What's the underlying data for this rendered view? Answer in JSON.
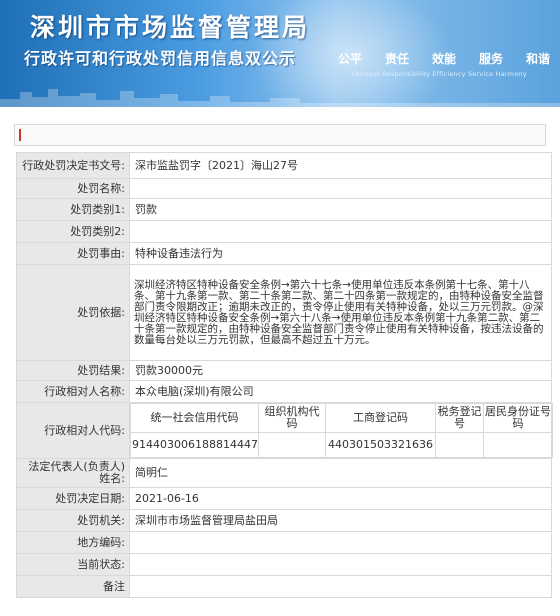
{
  "header": {
    "title": "深圳市市场监督管理局",
    "subtitle": "行政许可和行政处罚信用信息双公示",
    "slogans": [
      "公平",
      "责任",
      "效能",
      "服务",
      "和谐"
    ],
    "motto": "Fairness  Responsibility  Efficiency  Service  Harmony"
  },
  "record": {
    "decision_no_label": "行政处罚决定书文号:",
    "decision_no": "深市监盐罚字〔2021〕海山27号",
    "penalty_name_label": "处罚名称:",
    "penalty_name": "",
    "category1_label": "处罚类别1:",
    "category1": "罚款",
    "category2_label": "处罚类别2:",
    "category2": "",
    "cause_label": "处罚事由:",
    "cause": "特种设备违法行为",
    "basis_label": "处罚依据:",
    "basis": "深圳经济特区特种设备安全条例→第六十七条→使用单位违反本条例第十七条、第十八条、第十九条第一款、第二十条第二款、第二十四条第一款规定的，由特种设备安全监督部门责令限期改正；逾期未改正的，责令停止使用有关特种设备，处以三万元罚款。@深圳经济特区特种设备安全条例→第六十八条→使用单位违反本条例第十九条第二款、第二十条第一款规定的，由特种设备安全监督部门责令停止使用有关特种设备，按违法设备的数量每台处以三万元罚款，但最高不超过五十万元。",
    "result_label": "处罚结果:",
    "result": "罚款30000元",
    "party_name_label": "行政相对人名称:",
    "party_name": "本众电脑(深圳)有限公司",
    "party_code_label": "行政相对人代码:",
    "code_headers": [
      "统一社会信用代码",
      "组织机构代码",
      "工商登记码",
      "税务登记号",
      "居民身份证号码"
    ],
    "code_values": [
      "914403006188814447",
      "",
      "440301503321636",
      "",
      ""
    ],
    "legal_rep_label": "法定代表人(负责人)姓名:",
    "legal_rep": "简明仁",
    "decision_date_label": "处罚决定日期:",
    "decision_date": "2021-06-16",
    "authority_label": "处罚机关:",
    "authority": "深圳市市场监督管理局盐田局",
    "area_code_label": "地方编码:",
    "area_code": "",
    "status_label": "当前状态:",
    "status": "",
    "remark_label": "备注",
    "remark": ""
  }
}
